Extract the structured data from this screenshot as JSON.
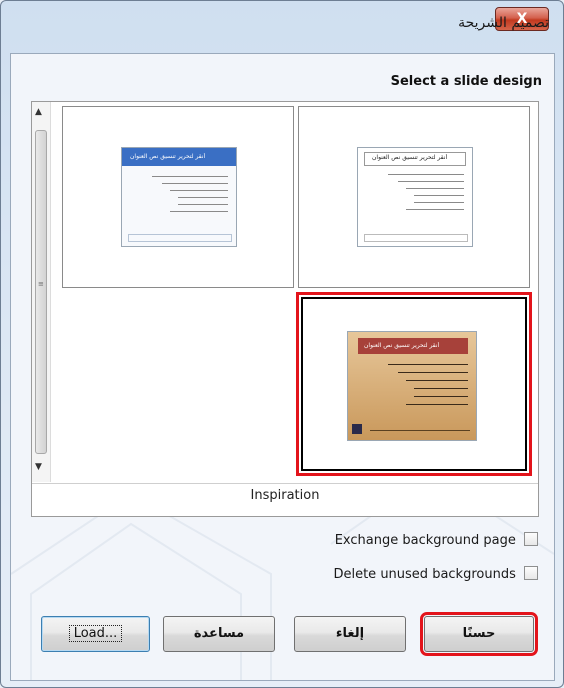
{
  "window": {
    "title": "تصميم الشريحة",
    "close_label": "X"
  },
  "heading": "Select a slide design",
  "slides": [
    {
      "title": "أنقر لتحرير تنسيق نص العنوان",
      "variant": "blue",
      "selected": false
    },
    {
      "title": "أنقر لتحرير تنسيق نص العنوان",
      "variant": "plain",
      "selected": false
    },
    {
      "title": "أنقر لتحرير تنسيق نص العنوان",
      "variant": "inspiration",
      "selected": true
    }
  ],
  "selected_design_name": "Inspiration",
  "options": {
    "exchange_background": "Exchange background page",
    "delete_unused": "Delete unused backgrounds"
  },
  "buttons": {
    "load": "Load...",
    "help": "مساعدة",
    "cancel": "إلغاء",
    "ok": "حسنًا"
  },
  "colors": {
    "selection": "#e3141b",
    "blue_title": "#3a6fc4",
    "inspiration_bg": "#d8b27a"
  }
}
